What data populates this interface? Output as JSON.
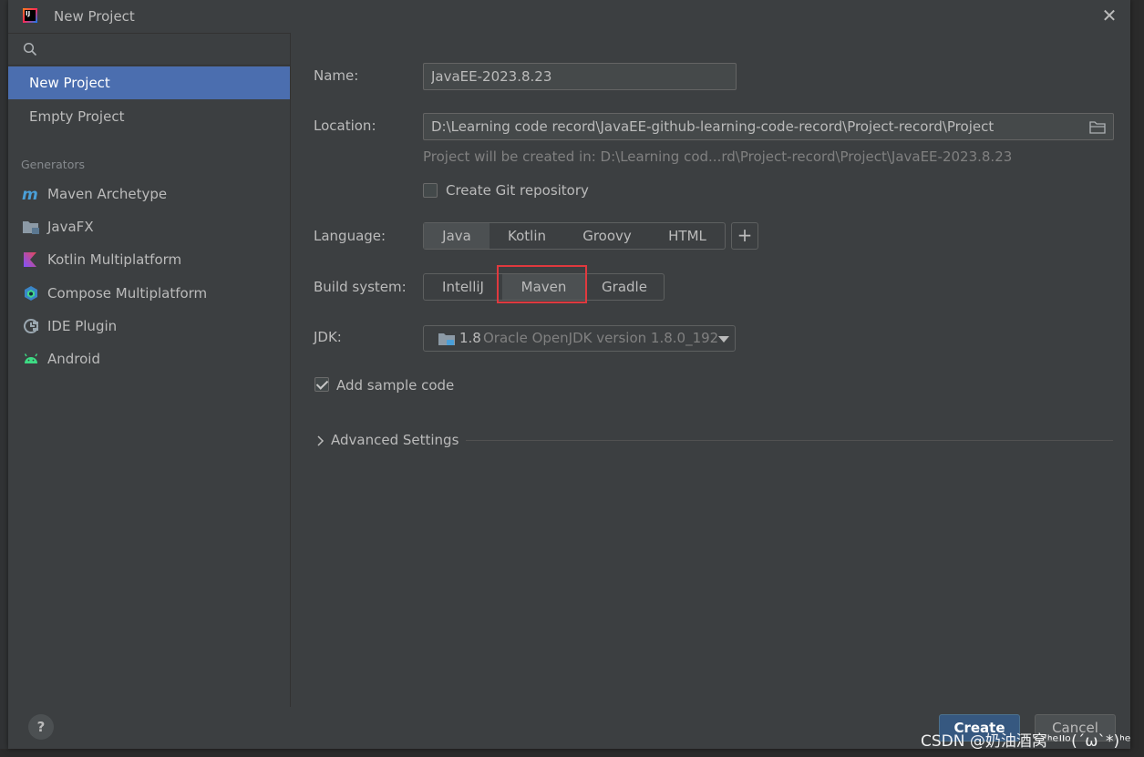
{
  "window": {
    "title": "New Project"
  },
  "sidebar": {
    "search_placeholder": "",
    "items": [
      {
        "label": "New Project",
        "selected": true
      },
      {
        "label": "Empty Project",
        "selected": false
      }
    ],
    "generators_header": "Generators",
    "generators": [
      {
        "label": "Maven Archetype",
        "icon": "maven-icon"
      },
      {
        "label": "JavaFX",
        "icon": "folder-icon"
      },
      {
        "label": "Kotlin Multiplatform",
        "icon": "kotlin-icon"
      },
      {
        "label": "Compose Multiplatform",
        "icon": "compose-icon"
      },
      {
        "label": "IDE Plugin",
        "icon": "plugin-icon"
      },
      {
        "label": "Android",
        "icon": "android-icon"
      }
    ],
    "help_label": "?"
  },
  "form": {
    "name_label": "Name:",
    "name_value": "JavaEE-2023.8.23",
    "location_label": "Location:",
    "location_value": "D:\\Learning code record\\JavaEE-github-learning-code-record\\Project-record\\Project",
    "location_hint": "Project will be created in: D:\\Learning cod...rd\\Project-record\\Project\\JavaEE-2023.8.23",
    "git_label": "Create Git repository",
    "git_checked": false,
    "language_label": "Language:",
    "languages": [
      "Java",
      "Kotlin",
      "Groovy",
      "HTML"
    ],
    "language_selected": "Java",
    "add_language_label": "+",
    "build_label": "Build system:",
    "build_systems": [
      "IntelliJ",
      "Maven",
      "Gradle"
    ],
    "build_selected": "Maven",
    "jdk_label": "JDK:",
    "jdk_version": "1.8",
    "jdk_description": "Oracle OpenJDK version 1.8.0_192",
    "sample_code_label": "Add sample code",
    "sample_code_checked": true,
    "advanced_label": "Advanced Settings"
  },
  "buttons": {
    "create": "Create",
    "cancel": "Cancel"
  },
  "watermark": "CSDN @奶油酒窝ᑋᵉᑊᑊᵒ(´ω`*)ᑋᵉ",
  "colors": {
    "accent": "#4b6eaf",
    "highlight_box": "#e0393e",
    "create_button": "#365880"
  }
}
